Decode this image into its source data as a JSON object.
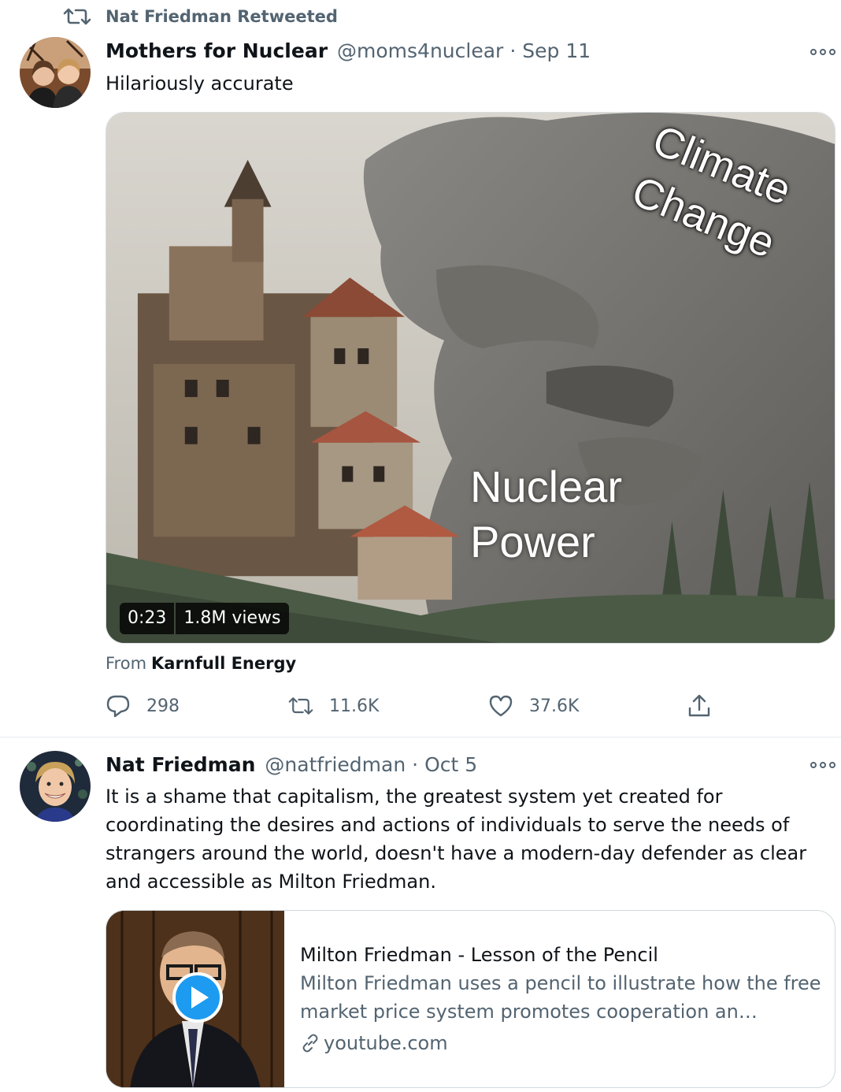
{
  "retweet_banner": {
    "label": "Nat Friedman Retweeted"
  },
  "tweet1": {
    "author_name": "Mothers for Nuclear",
    "handle": "@moms4nuclear",
    "separator": "·",
    "date": "Sep 11",
    "text": "Hilariously accurate",
    "media": {
      "overlay_top": [
        "Climate",
        "Change"
      ],
      "overlay_bottom": [
        "Nuclear",
        "Power"
      ],
      "duration": "0:23",
      "views": "1.8M views"
    },
    "from_prefix": "From",
    "from_source": "Karnfull Energy",
    "actions": {
      "reply_count": "298",
      "retweet_count": "11.6K",
      "like_count": "37.6K"
    }
  },
  "tweet2": {
    "author_name": "Nat Friedman",
    "handle": "@natfriedman",
    "separator": "·",
    "date": "Oct 5",
    "text_lines": [
      "It is a shame that capitalism, the greatest system yet created for",
      "coordinating the desires and actions of individuals to serve the needs of",
      "strangers around the world, doesn't have a modern-day defender as clear",
      "and accessible as Milton Friedman."
    ],
    "link_card": {
      "title": "Milton Friedman - Lesson of the Pencil",
      "description": "Milton Friedman uses a pencil to illustrate how the free market price system promotes cooperation an…",
      "domain": "youtube.com"
    }
  },
  "colors": {
    "secondary_text": "#536471",
    "primary_text": "#0f1419",
    "accent_blue": "#1d9bf0"
  }
}
